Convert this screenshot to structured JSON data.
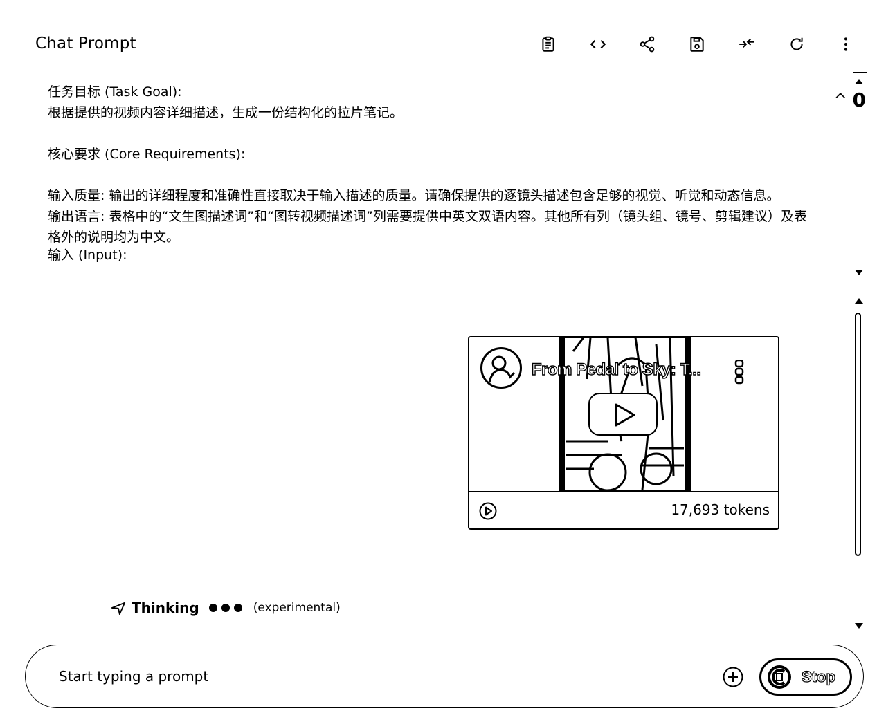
{
  "header": {
    "title": "Chat Prompt",
    "toolbar": [
      {
        "icon": "clipboard-icon"
      },
      {
        "icon": "code-icon"
      },
      {
        "icon": "share-icon"
      },
      {
        "icon": "save-icon"
      },
      {
        "icon": "compare-icon"
      },
      {
        "icon": "refresh-icon"
      },
      {
        "icon": "more-vert-icon"
      }
    ]
  },
  "prompt": {
    "lines": [
      "任务目标 (Task Goal):",
      "根据提供的视频内容详细描述，生成一份结构化的拉片笔记。",
      "核心要求 (Core Requirements):",
      "输入质量: 输出的详细程度和准确性直接取决于输入描述的质量。请确保提供的逐镜头描述包含足够的视觉、听觉和动态信息。",
      "输出语言: 表格中的“文生图描述词”和“图转视频描述词”列需要提供中英文双语内容。其他所有列（镜头组、镜号、剪辑建议）及表格外的说明均为中文。",
      "输入 (Input):"
    ]
  },
  "nav": {
    "match_count": "0"
  },
  "video": {
    "title": "From Pedal to Sky: T...",
    "tokens": "17,693 tokens"
  },
  "thinking": {
    "label": "Thinking",
    "note": "(experimental)"
  },
  "input": {
    "placeholder": "Start typing a prompt",
    "stop_label": "Stop"
  }
}
